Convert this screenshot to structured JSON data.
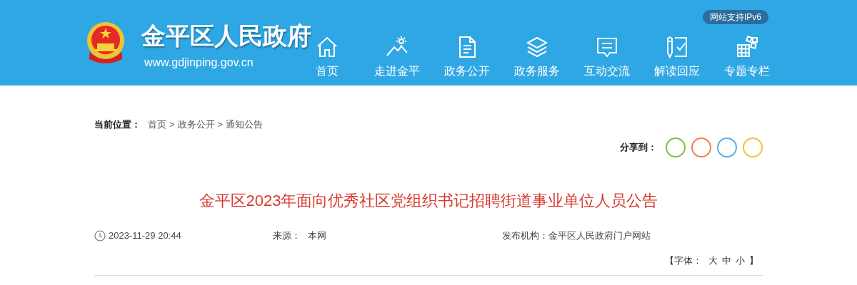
{
  "header": {
    "site_name": "金平区人民政府",
    "site_url": "www.gdjinping.gov.cn",
    "ipv6_badge": "网站支持IPv6",
    "nav": [
      {
        "label": "首页"
      },
      {
        "label": "走进金平"
      },
      {
        "label": "政务公开"
      },
      {
        "label": "政务服务"
      },
      {
        "label": "互动交流"
      },
      {
        "label": "解读回应"
      },
      {
        "label": "专题专栏"
      }
    ]
  },
  "breadcrumb": {
    "label": "当前位置：",
    "separator": ">",
    "items": [
      "首页",
      "政务公开",
      "通知公告"
    ]
  },
  "share": {
    "label": "分享到：",
    "buttons": [
      {
        "color": "#7cc04b"
      },
      {
        "color": "#f08050"
      },
      {
        "color": "#5aaee8"
      },
      {
        "color": "#f5c040"
      }
    ]
  },
  "article": {
    "title": "金平区2023年面向优秀社区党组织书记招聘街道事业单位人员公告",
    "date": "2023-11-29 20:44",
    "source_label": "来源：",
    "source": "本网",
    "publisher_label": "发布机构：",
    "publisher": "金平区人民政府门户网站",
    "font_size": {
      "open": "【字体：",
      "options": [
        "大",
        "中",
        "小"
      ],
      "close": "】"
    }
  }
}
